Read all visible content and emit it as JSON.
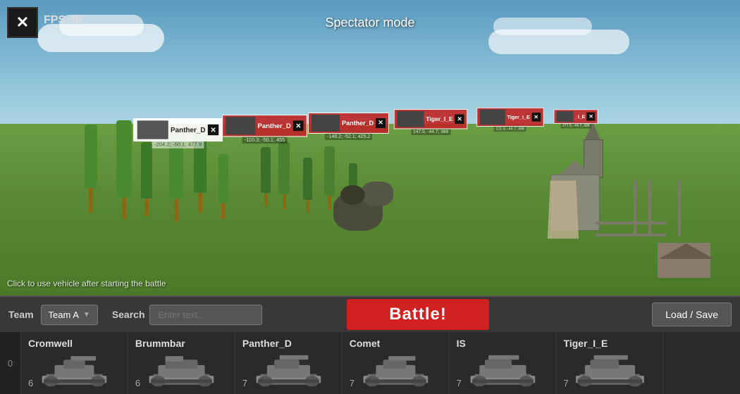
{
  "hud": {
    "close_icon": "✕",
    "fps_label": "FPS:58",
    "spectator_label": "Spectator mode",
    "click_hint": "Click to use vehicle after starting the battle"
  },
  "controls": {
    "team_label": "Team",
    "team_value": "Team A",
    "search_label": "Search",
    "search_placeholder": "Enter text...",
    "battle_button": "Battle!",
    "load_save_button": "Load / Save"
  },
  "vehicle_markers": [
    {
      "name": "Panther_D",
      "coords": "-204.2; -50.1; 477.9",
      "team": "white"
    },
    {
      "name": "Panther_D",
      "coords": "-110.3; -50.1; 455.2",
      "team": "red"
    },
    {
      "name": "Panther_D",
      "coords": "-148.2; -52.1; 425.2",
      "team": "red"
    },
    {
      "name": "Tiger_I_E",
      "coords": "147.5; -44.7; 388.0",
      "team": "red"
    },
    {
      "name": "Tiger_I_E",
      "coords": "211.5; -44.7; 388.1",
      "team": "red"
    },
    {
      "name": "_I_E",
      "coords": "277.5; -44.7; 388.1",
      "team": "red"
    }
  ],
  "vehicle_list": [
    {
      "name": "Cromwell",
      "count": "6"
    },
    {
      "name": "Brummbar",
      "count": "6"
    },
    {
      "name": "Panther_D",
      "count": "7"
    },
    {
      "name": "Comet",
      "count": "7"
    },
    {
      "name": "IS",
      "count": "7"
    },
    {
      "name": "Tiger_I_E",
      "count": "7"
    }
  ],
  "colors": {
    "battle_btn": "#d02020",
    "red_team": "#cc2222",
    "dark_bg": "#2a2a2a",
    "controls_bg": "#383838"
  }
}
